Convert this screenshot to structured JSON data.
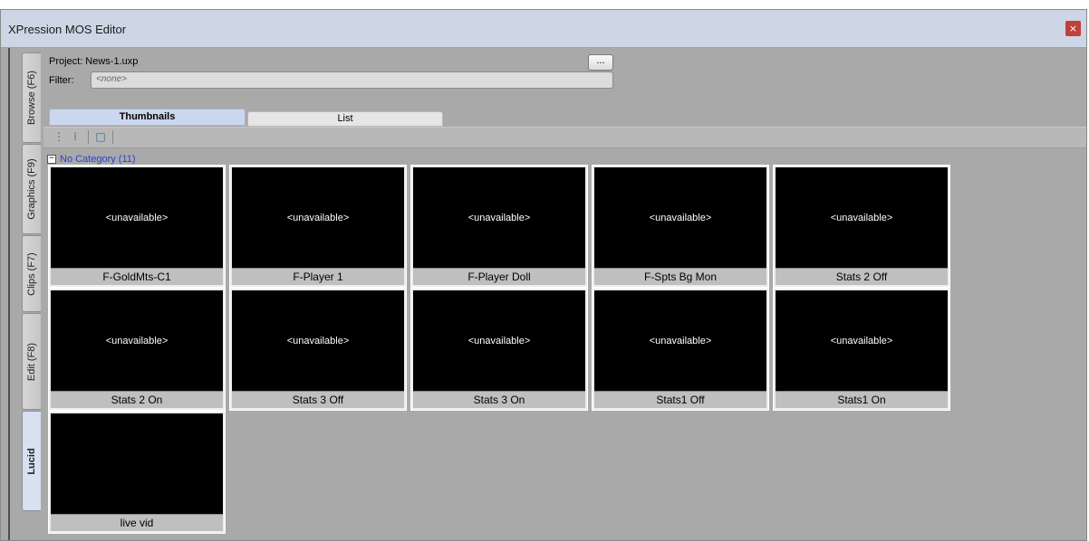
{
  "window": {
    "title": "XPression MOS Editor",
    "close_glyph": "×"
  },
  "side_tabs": [
    {
      "label": "Browse (F6)",
      "active": false
    },
    {
      "label": "Graphics (F9)",
      "active": false
    },
    {
      "label": "Clips (F7)",
      "active": false
    },
    {
      "label": "Edit (F8)",
      "active": false
    },
    {
      "label": "Lucid",
      "active": true
    }
  ],
  "project": {
    "label": "Project:",
    "value": "News-1.uxp",
    "browse_label": "..."
  },
  "filter": {
    "label": "Filter:",
    "placeholder": "<none>"
  },
  "view_tabs": {
    "thumbnails": "Thumbnails",
    "list": "List",
    "active": "thumbnails"
  },
  "toolbar": {
    "icons": [
      "expand-all-icon",
      "collapse-all-icon",
      "frame-view-icon"
    ]
  },
  "category": {
    "expander": "−",
    "label": "No Category (11)"
  },
  "items": [
    {
      "name": "F-GoldMts-C1",
      "thumb": "<unavailable>"
    },
    {
      "name": "F-Player  1",
      "thumb": "<unavailable>"
    },
    {
      "name": "F-Player Doll",
      "thumb": "<unavailable>"
    },
    {
      "name": "F-Spts Bg Mon",
      "thumb": "<unavailable>"
    },
    {
      "name": "Stats 2 Off",
      "thumb": "<unavailable>"
    },
    {
      "name": "Stats 2 On",
      "thumb": "<unavailable>"
    },
    {
      "name": "Stats 3 Off",
      "thumb": "<unavailable>"
    },
    {
      "name": "Stats 3 On",
      "thumb": "<unavailable>"
    },
    {
      "name": "Stats1 Off",
      "thumb": "<unavailable>"
    },
    {
      "name": "Stats1 On",
      "thumb": "<unavailable>"
    },
    {
      "name": "live vid",
      "thumb": ""
    }
  ]
}
